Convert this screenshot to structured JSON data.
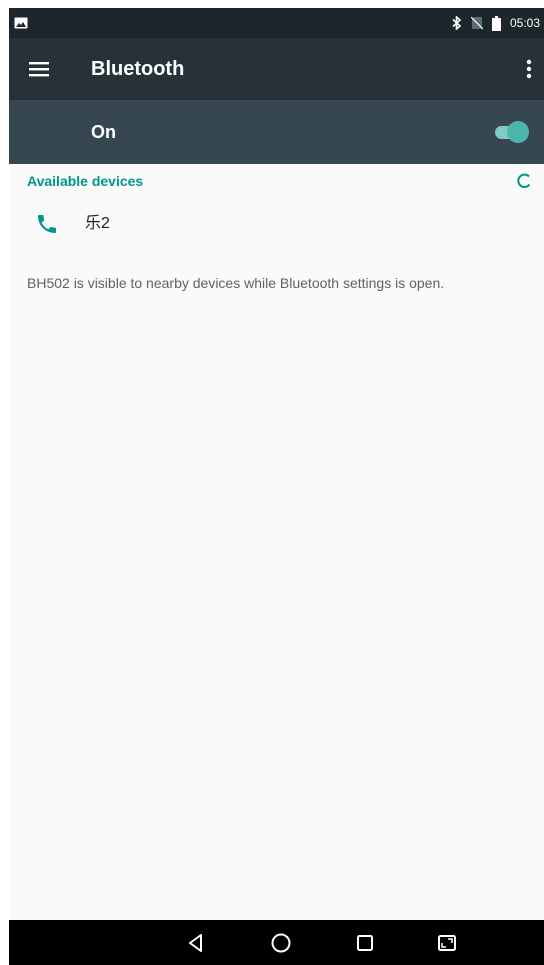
{
  "status_bar": {
    "time": "05:03",
    "icons": [
      "image-icon",
      "bluetooth-icon",
      "no-sim-icon",
      "battery-icon"
    ]
  },
  "app_bar": {
    "title": "Bluetooth",
    "menu_icon": "hamburger-menu-icon",
    "overflow_icon": "more-vertical-icon"
  },
  "switch_bar": {
    "label": "On",
    "state": "on"
  },
  "devices_section": {
    "header": "Available devices",
    "refresh_icon": "refresh-icon",
    "devices": [
      {
        "name": "乐2",
        "icon": "phone-icon"
      }
    ]
  },
  "visibility_note": "BH502 is visible to nearby devices while Bluetooth settings is open.",
  "nav_bar": {
    "buttons": [
      "back-icon",
      "home-icon",
      "recents-icon",
      "screenshot-icon"
    ]
  },
  "colors": {
    "accent": "#009688",
    "toolbar": "#263238",
    "switch_bar": "#37474f",
    "status_bar": "#1c262b",
    "toggle_thumb": "#4db6ac"
  }
}
